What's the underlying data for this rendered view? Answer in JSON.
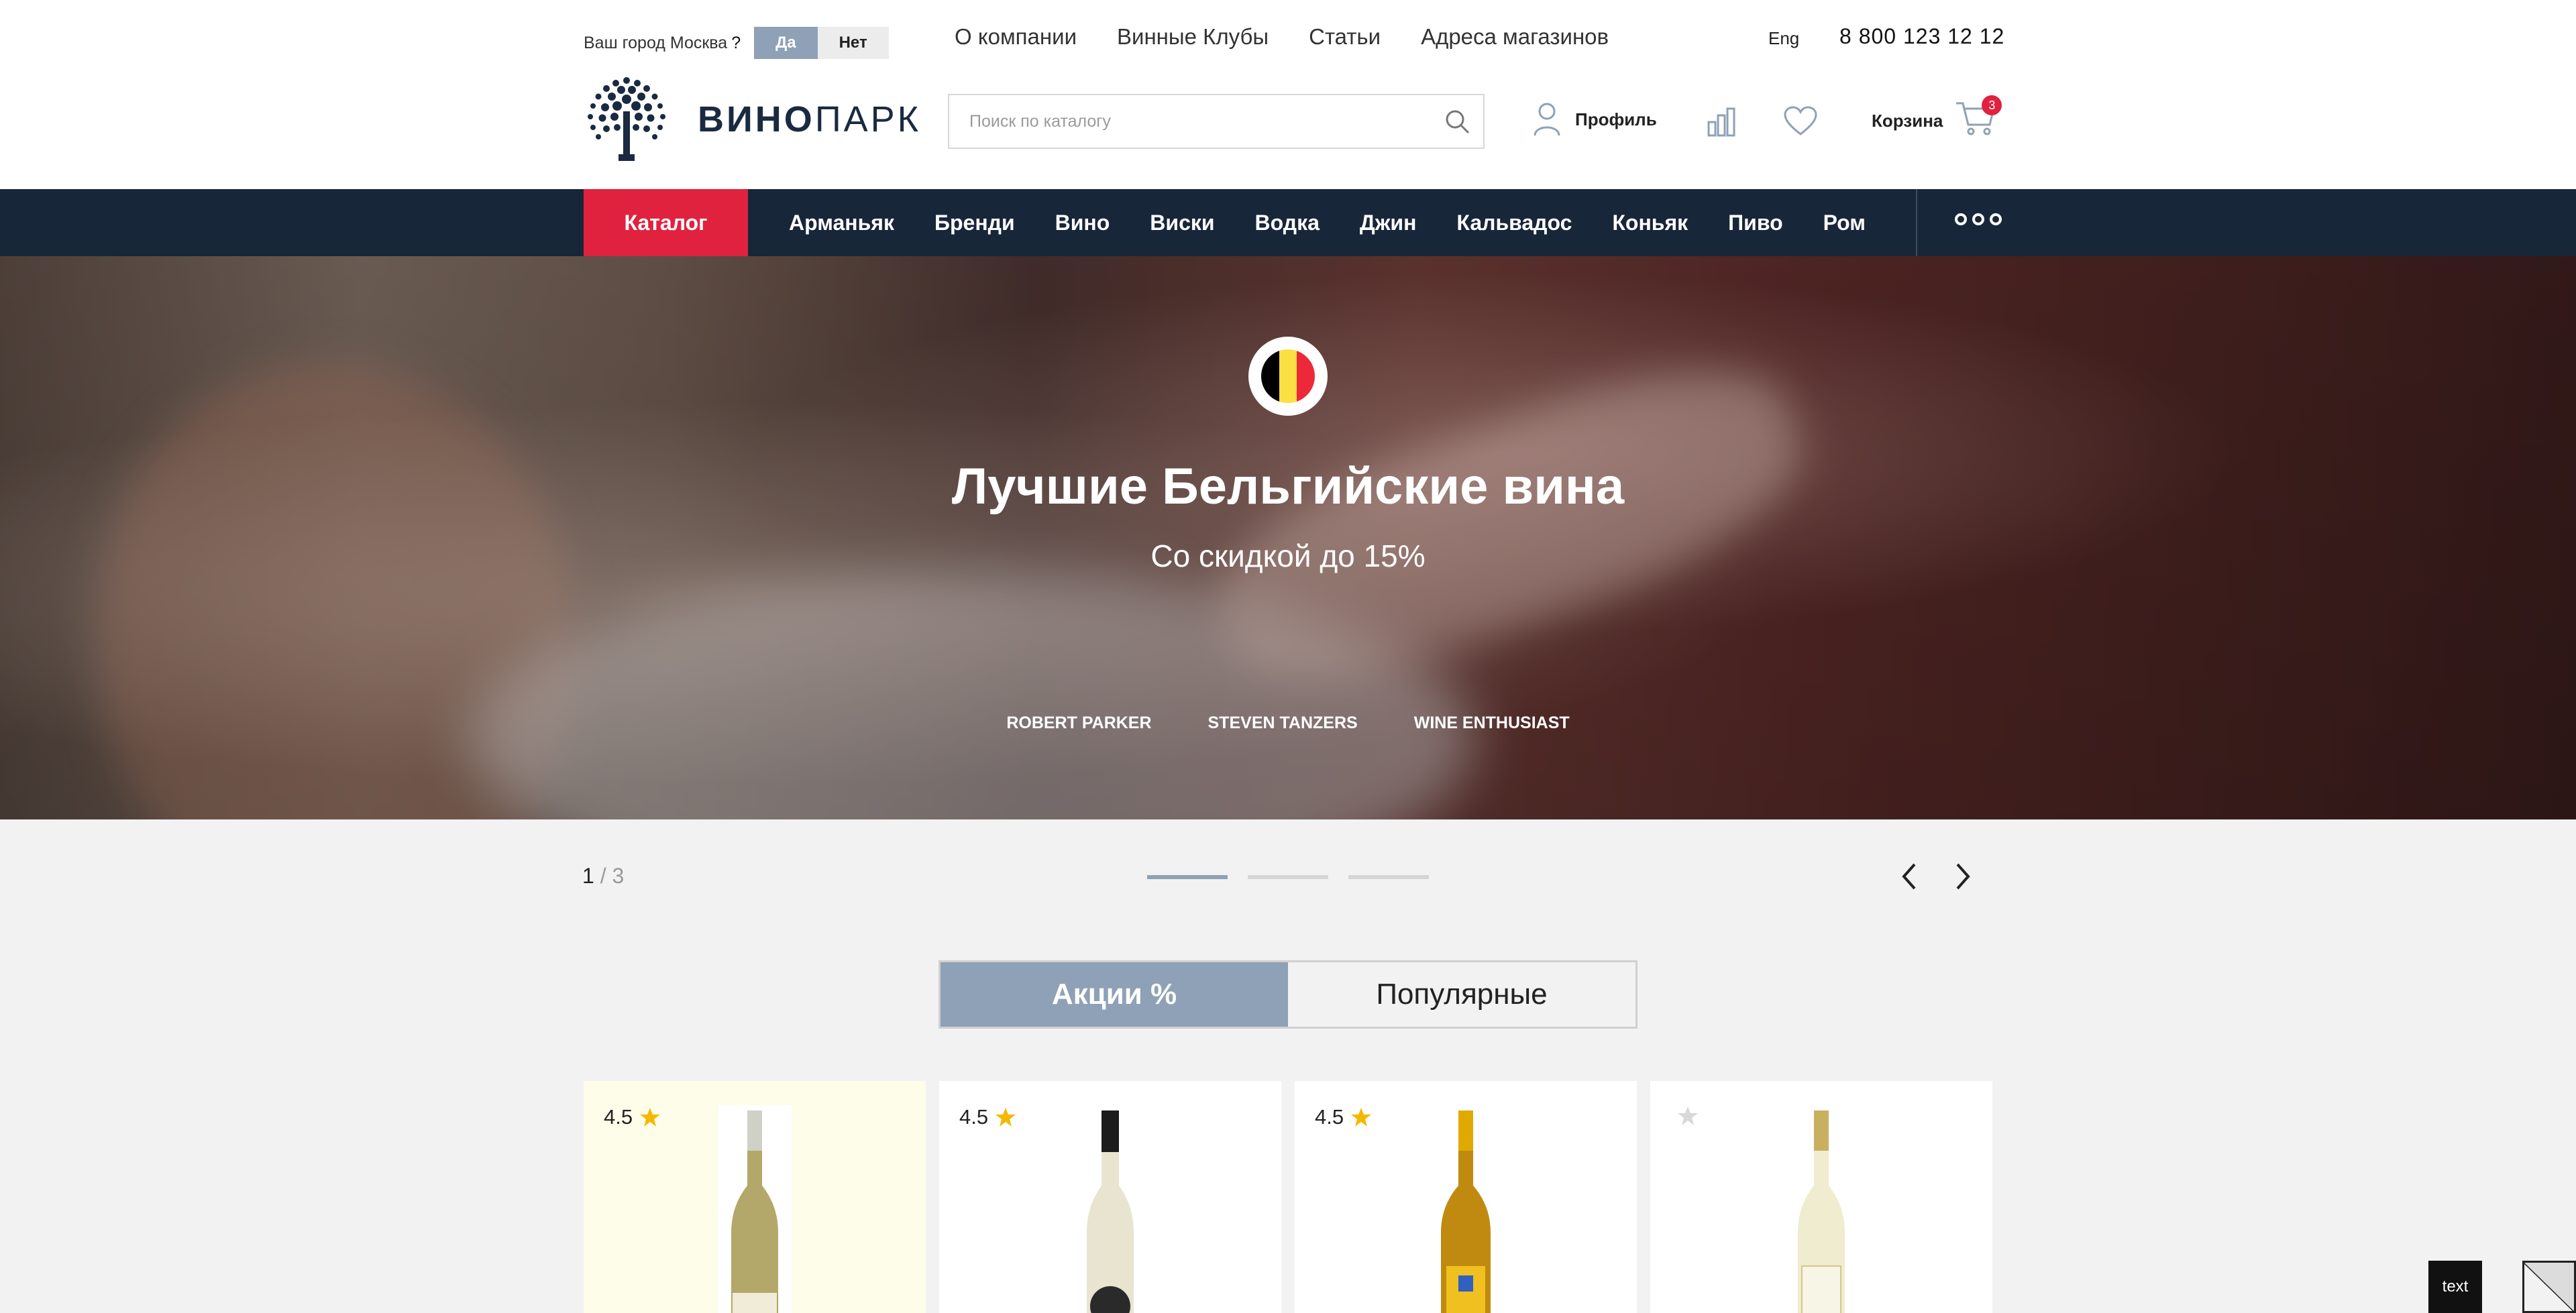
{
  "header": {
    "city_label": "Ваш город",
    "city_name": "Москва",
    "city_question": "?",
    "yes_label": "Да",
    "no_label": "Нет",
    "top_links": [
      "О компании",
      "Винные Клубы",
      "Статьи",
      "Адреса магазинов"
    ],
    "lang": "Eng",
    "phone": "8 800 123 12 12",
    "logo_bold": "ВИНО",
    "logo_light": "ПАРК",
    "search_placeholder": "Поиск по каталогу",
    "profile_label": "Профиль",
    "cart_label": "Корзина",
    "cart_count": "3"
  },
  "nav": {
    "catalog_label": "Каталог",
    "categories": [
      "Арманьяк",
      "Бренди",
      "Вино",
      "Виски",
      "Водка",
      "Джин",
      "Кальвадос",
      "Коньяк",
      "Пиво",
      "Ром"
    ]
  },
  "hero": {
    "title": "Лучшие Бельгийские вина",
    "subtitle": "Со скидкой до 15%",
    "flag_colors": [
      "#000000",
      "#fae042",
      "#ed2939"
    ],
    "ratings": [
      "ROBERT PARKER",
      "STEVEN TANZERS",
      "WINE ENTHUSIAST"
    ]
  },
  "slider": {
    "current": "1",
    "separator": " / ",
    "total": "3"
  },
  "tabs": [
    {
      "label": "Акции %",
      "active": true
    },
    {
      "label": "Популярные",
      "active": false
    }
  ],
  "products": [
    {
      "rating": "4.5",
      "highlighted": true
    },
    {
      "rating": "4.5",
      "highlighted": false
    },
    {
      "rating": "4.5",
      "highlighted": false
    },
    {
      "rating": "",
      "highlighted": false
    }
  ],
  "floating_label": "text",
  "colors": {
    "accent_red": "#e0223f",
    "nav_dark": "#172638",
    "steel_blue": "#8ea1b6",
    "star_yellow": "#f5b800"
  }
}
